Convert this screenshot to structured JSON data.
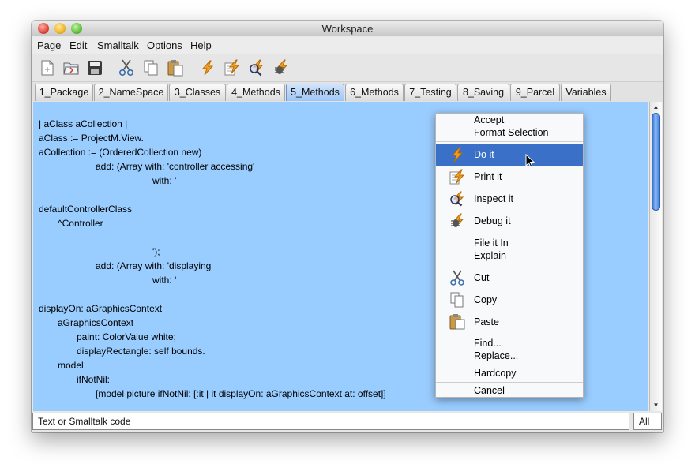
{
  "window": {
    "title": "Workspace"
  },
  "menubar": [
    "Page",
    "Edit",
    "Smalltalk",
    "Options",
    "Help"
  ],
  "toolbar": {
    "icons": [
      "new-page-icon",
      "open-icon",
      "save-icon",
      "cut-icon",
      "copy-icon",
      "paste-icon",
      "do-it-icon",
      "print-it-icon",
      "inspect-it-icon",
      "debug-it-icon"
    ]
  },
  "tabs": [
    {
      "label": "1_Package"
    },
    {
      "label": "2_NameSpace"
    },
    {
      "label": "3_Classes"
    },
    {
      "label": "4_Methods"
    },
    {
      "label": "5_Methods",
      "active": true
    },
    {
      "label": "6_Methods"
    },
    {
      "label": "7_Testing"
    },
    {
      "label": "8_Saving"
    },
    {
      "label": "9_Parcel"
    },
    {
      "label": "Variables"
    }
  ],
  "editor": {
    "background": "#99ccff",
    "lines": [
      "| aClass aCollection |",
      "aClass := ProjectM.View.",
      "aCollection := (OrderedCollection new)",
      "add: (Array with: 'controller accessing'",
      "with: '",
      "defaultControllerClass",
      "^Controller",
      "');",
      "add: (Array with: 'displaying'",
      "with: '",
      "displayOn: aGraphicsContext",
      "aGraphicsContext",
      "paint: ColorValue white;",
      "displayRectangle: self bounds.",
      "model",
      "ifNotNil:",
      "[model picture ifNotNil: [:it | it displayOn: aGraphicsContext at: offset]]"
    ]
  },
  "context_menu": {
    "group1": [
      "Accept",
      "Format Selection"
    ],
    "group2": [
      {
        "label": "Do it",
        "icon": "do-it-icon",
        "highlighted": true
      },
      {
        "label": "Print it",
        "icon": "print-it-icon"
      },
      {
        "label": "Inspect it",
        "icon": "inspect-it-icon"
      },
      {
        "label": "Debug it",
        "icon": "debug-it-icon"
      }
    ],
    "group3": [
      "File it In",
      "Explain"
    ],
    "group4": [
      {
        "label": "Cut",
        "icon": "cut-icon"
      },
      {
        "label": "Copy",
        "icon": "copy-icon"
      },
      {
        "label": "Paste",
        "icon": "paste-icon"
      }
    ],
    "group5": [
      "Find...",
      "Replace..."
    ],
    "group6": [
      "Hardcopy"
    ],
    "group7": [
      "Cancel"
    ],
    "highlight_color": "#3a70c8"
  },
  "statusbar": {
    "text": "Text or Smalltalk code",
    "scope": "All"
  }
}
